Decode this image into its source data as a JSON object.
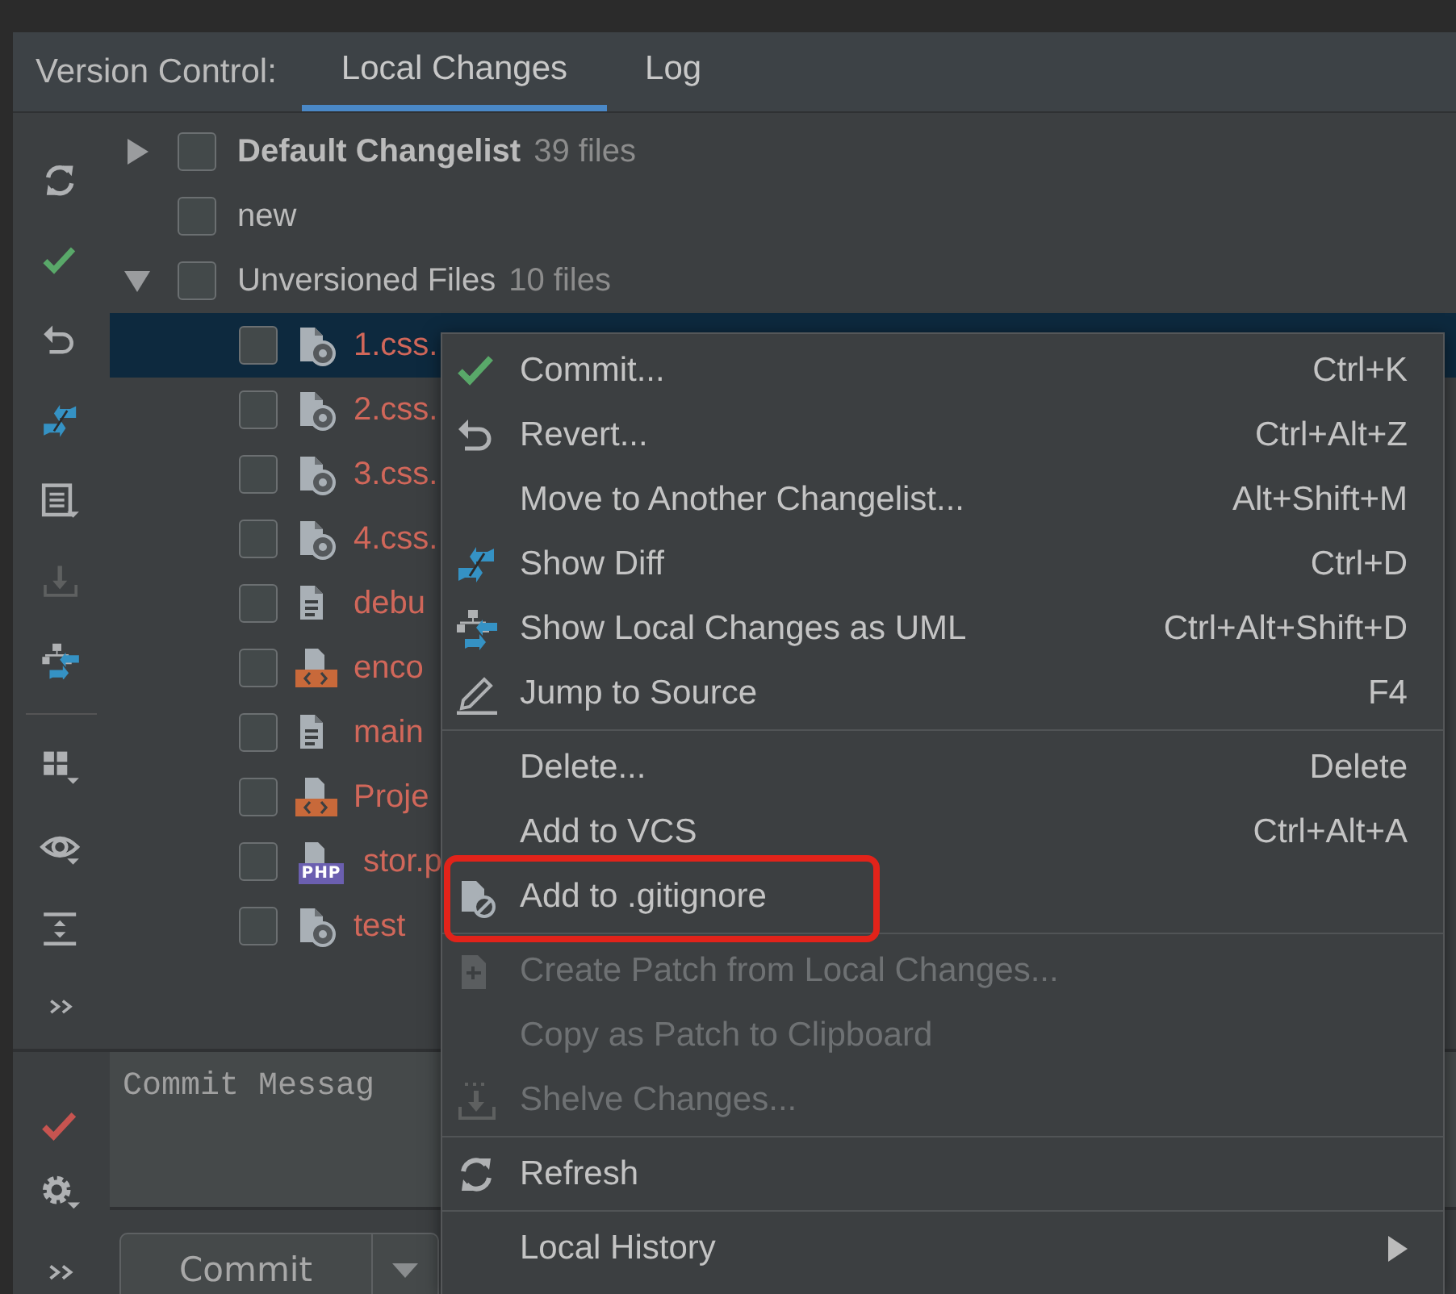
{
  "tool_window": {
    "title": "Version Control:",
    "tabs": [
      {
        "label": "Local Changes",
        "selected": true
      },
      {
        "label": "Log",
        "selected": false
      }
    ]
  },
  "tree": [
    {
      "label": "Default Changelist",
      "count": "39 files",
      "default": true,
      "expanded": false,
      "checked": false,
      "selected": false
    },
    {
      "label": "new",
      "default": false,
      "checked": false,
      "selected": false
    },
    {
      "label": "Unversioned Files",
      "count": "10 files",
      "default": false,
      "expanded": true,
      "checked": false,
      "selected": false,
      "children": [
        {
          "label": "1.css.",
          "kind": "stylesheet",
          "checked": false,
          "selected": true
        },
        {
          "label": "2.css.",
          "kind": "stylesheet",
          "checked": false,
          "selected": false
        },
        {
          "label": "3.css.",
          "kind": "stylesheet",
          "checked": false,
          "selected": false
        },
        {
          "label": "4.css.",
          "kind": "stylesheet",
          "checked": false,
          "selected": false
        },
        {
          "label": "debu",
          "kind": "text",
          "checked": false,
          "selected": false
        },
        {
          "label": "enco",
          "kind": "markup",
          "checked": false,
          "selected": false
        },
        {
          "label": "main",
          "kind": "text",
          "checked": false,
          "selected": false
        },
        {
          "label": "Proje",
          "kind": "markup",
          "checked": false,
          "selected": false
        },
        {
          "label": "stor.p",
          "kind": "php",
          "badge": "PHP",
          "checked": false,
          "selected": false
        },
        {
          "label": "test",
          "kind": "stylesheet",
          "checked": false,
          "selected": false
        }
      ]
    }
  ],
  "commit": {
    "placeholder": "Commit Messag",
    "button": "Commit"
  },
  "menu": {
    "groups": [
      {
        "items": [
          {
            "label": "Commit...",
            "shortcut": "Ctrl+K",
            "disabled": false
          },
          {
            "label": "Revert...",
            "shortcut": "Ctrl+Alt+Z",
            "disabled": false
          },
          {
            "label": "Move to Another Changelist...",
            "shortcut": "Alt+Shift+M",
            "disabled": false
          },
          {
            "label": "Show Diff",
            "shortcut": "Ctrl+D",
            "disabled": false
          },
          {
            "label": "Show Local Changes as UML",
            "shortcut": "Ctrl+Alt+Shift+D",
            "disabled": false
          },
          {
            "label": "Jump to Source",
            "shortcut": "F4",
            "disabled": false
          }
        ]
      },
      {
        "items": [
          {
            "label": "Delete...",
            "shortcut": "Delete",
            "disabled": false
          },
          {
            "label": "Add to VCS",
            "shortcut": "Ctrl+Alt+A",
            "disabled": false
          },
          {
            "label": "Add to .gitignore",
            "disabled": false,
            "highlighted": true
          }
        ]
      },
      {
        "items": [
          {
            "label": "Create Patch from Local Changes...",
            "disabled": true
          },
          {
            "label": "Copy as Patch to Clipboard",
            "disabled": true
          },
          {
            "label": "Shelve Changes...",
            "disabled": true
          }
        ]
      },
      {
        "items": [
          {
            "label": "Refresh",
            "disabled": false
          }
        ]
      },
      {
        "items": [
          {
            "label": "Local History",
            "disabled": false,
            "submenu": true
          }
        ]
      }
    ]
  }
}
